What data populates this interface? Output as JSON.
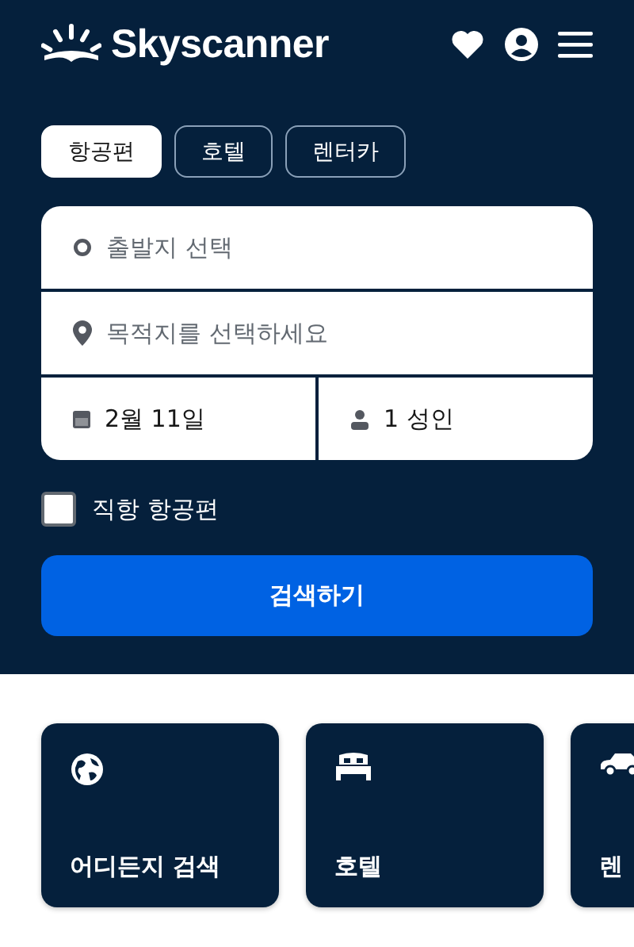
{
  "header": {
    "logo_text": "Skyscanner"
  },
  "tabs": [
    {
      "label": "항공편",
      "selected": true
    },
    {
      "label": "호텔",
      "selected": false
    },
    {
      "label": "렌터카",
      "selected": false
    }
  ],
  "form": {
    "origin": {
      "placeholder": "출발지 선택"
    },
    "destination": {
      "placeholder": "목적지를 선택하세요"
    },
    "date": {
      "value": "2월 11일"
    },
    "travellers": {
      "value": "1 성인"
    }
  },
  "direct_flights": {
    "label": "직항 항공편",
    "checked": false
  },
  "search_button": "검색하기",
  "cards": [
    {
      "kind": "globe",
      "label": "어디든지 검색"
    },
    {
      "kind": "bed",
      "label": "호텔"
    },
    {
      "kind": "car",
      "label": "렌"
    }
  ]
}
